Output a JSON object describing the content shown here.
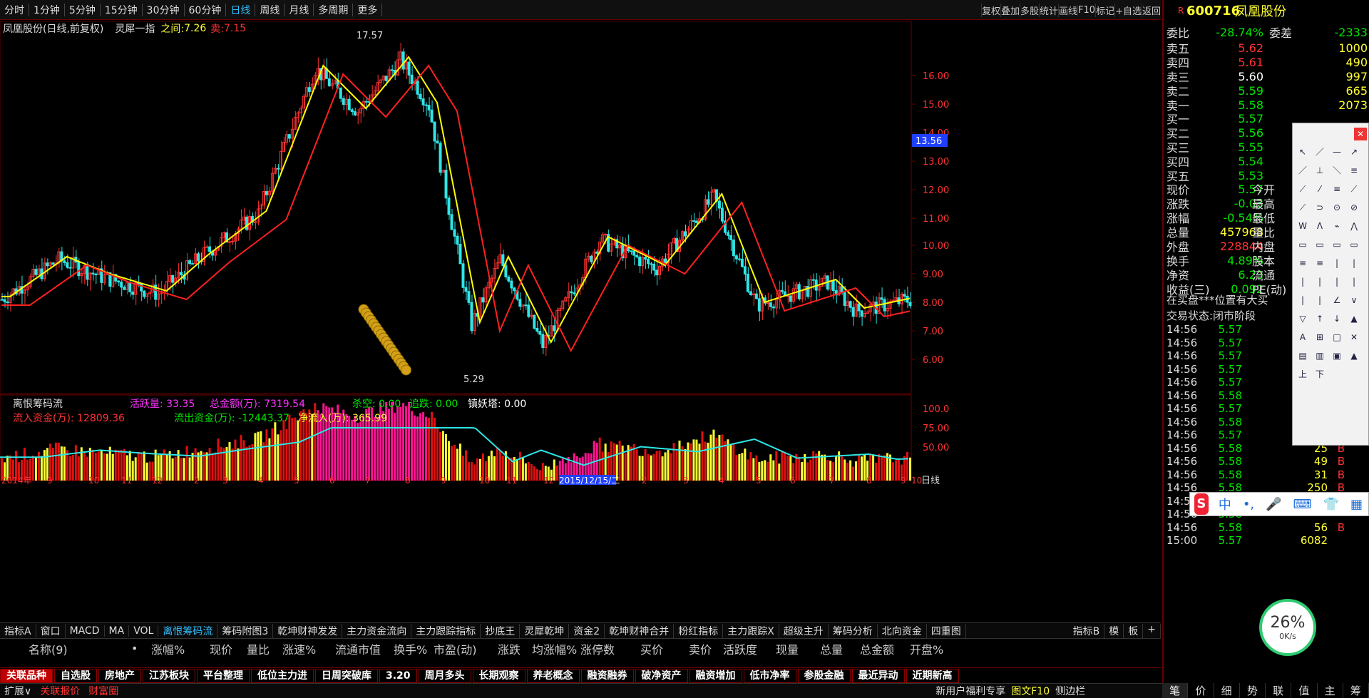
{
  "toolbar": {
    "periods": [
      "分时",
      "1分钟",
      "5分钟",
      "15分钟",
      "30分钟",
      "60分钟",
      "日线",
      "周线",
      "月线",
      "多周期",
      "更多"
    ],
    "active": "日线",
    "right": [
      "复权",
      "叠加",
      "多股",
      "统计",
      "画线",
      "F10",
      "标记",
      "+自选",
      "返回"
    ]
  },
  "chart": {
    "stock_title": "凤凰股份(日线,前复权)",
    "indicator_name": "灵犀一指",
    "between_label": "之间:",
    "between_value": "7.26",
    "sell_label": "卖:",
    "sell_value": "7.15",
    "high_label": "17.57",
    "low_label": "5.29",
    "current_price_tag": "13.56",
    "y_ticks": [
      "16.00",
      "15.00",
      "14.00",
      "13.00",
      "12.00",
      "11.00",
      "10.00",
      "9.00",
      "8.00",
      "7.00",
      "6.00"
    ],
    "date_labels": [
      "2014年",
      "9",
      "10",
      "11",
      "12",
      "2",
      "3",
      "4",
      "5",
      "6",
      "7",
      "8",
      "9",
      "10",
      "11",
      "12",
      "2015/12/15/二",
      "2",
      "3",
      "4",
      "5",
      "6",
      "7",
      "8",
      "9",
      "10"
    ],
    "period_label": "日线"
  },
  "sub": {
    "name": "离恨筹码流",
    "l1": "活跃量: 33.35",
    "l1b": "总金额(万): 7319.54",
    "l2": "杀空: 0.00",
    "l3": "追跌: 0.00",
    "l4": "镇妖塔: 0.00",
    "in": "流入资金(万): 12809.36",
    "out": "流出资金(万): -12443.37",
    "net": "净流入(万): 365.99",
    "y_ticks": [
      "100.0",
      "75.00",
      "50.00"
    ]
  },
  "tabs": [
    "指标A",
    "窗口",
    "MACD",
    "MA",
    "VOL",
    "离恨筹码流",
    "筹码附图3",
    "乾坤财神发发",
    "主力资金流向",
    "主力跟踪指标",
    "抄底王",
    "灵犀乾坤",
    "资金2",
    "乾坤财神合并",
    "粉红指标",
    "主力跟踪X",
    "超级主升",
    "筹码分析",
    "北向资金",
    "四重图"
  ],
  "tabs_active": "离恨筹码流",
  "tabs_right": [
    "指标B",
    "模",
    "板",
    "+"
  ],
  "table_header": [
    "名称(9)",
    "•",
    "涨幅%",
    "现价",
    "量比",
    "涨速%",
    "流通市值",
    "换手%",
    "市盈(动)",
    "涨跌",
    "均涨幅%",
    "涨停数",
    "买价",
    "卖价",
    "活跃度",
    "现量",
    "总量",
    "总金额",
    "开盘%"
  ],
  "sectors": [
    "关联品种",
    "自选股",
    "房地产",
    "江苏板块",
    "平台整理",
    "低位主力进",
    "日周突破库",
    "3.20",
    "周月多头",
    "长期观察",
    "养老概念",
    "融资融券",
    "破净资产",
    "融资增加",
    "低市净率",
    "参股金融",
    "最近异动",
    "近期新高"
  ],
  "status": {
    "items": [
      "扩展∨",
      "关联报价",
      "财富圈"
    ],
    "right": [
      "新用户福利专享",
      "图文F10",
      "侧边栏"
    ]
  },
  "quote": {
    "code": "600716",
    "name": "凤凰股份",
    "ratio_label": "委比",
    "ratio": "-28.74%",
    "diff_label": "委差",
    "diff": "-2333",
    "asks": [
      [
        "卖五",
        "5.62",
        "1000"
      ],
      [
        "卖四",
        "5.61",
        "490"
      ],
      [
        "卖三",
        "5.60",
        "997"
      ],
      [
        "卖二",
        "5.59",
        "665"
      ],
      [
        "卖一",
        "5.58",
        "2073"
      ]
    ],
    "bids": [
      [
        "买一",
        "5.57",
        ""
      ],
      [
        "买二",
        "5.56",
        ""
      ],
      [
        "买三",
        "5.55",
        ""
      ],
      [
        "买四",
        "5.54",
        ""
      ],
      [
        "买五",
        "5.53",
        ""
      ]
    ],
    "stats": [
      [
        "现价",
        "5.57",
        "今开"
      ],
      [
        "涨跌",
        "-0.03",
        "最高"
      ],
      [
        "涨幅",
        "-0.54%",
        "最低"
      ],
      [
        "总量",
        "457968",
        "量比"
      ],
      [
        "外盘",
        "228844",
        "内盘"
      ],
      [
        "换手",
        "4.89%",
        "股本"
      ],
      [
        "净资",
        "6.23",
        "流通"
      ],
      [
        "收益(三)",
        "0.092",
        "PE(动)"
      ]
    ],
    "notice1": "在买盘***位置有大买",
    "notice2": "交易状态:闭市阶段",
    "ticks": [
      [
        "14:56",
        "5.57",
        "",
        ""
      ],
      [
        "14:56",
        "5.57",
        "",
        ""
      ],
      [
        "14:56",
        "5.57",
        "",
        ""
      ],
      [
        "14:56",
        "5.57",
        "278",
        "S"
      ],
      [
        "14:56",
        "5.57",
        "88",
        "S"
      ],
      [
        "14:56",
        "5.58",
        "410",
        "B"
      ],
      [
        "14:56",
        "5.57",
        "",
        ""
      ],
      [
        "14:56",
        "5.58",
        "",
        ""
      ],
      [
        "14:56",
        "5.57",
        "105",
        "S"
      ],
      [
        "14:56",
        "5.58",
        "25",
        "B"
      ],
      [
        "14:56",
        "5.58",
        "49",
        "B"
      ],
      [
        "14:56",
        "5.58",
        "31",
        "B"
      ],
      [
        "14:56",
        "5.58",
        "250",
        "B"
      ],
      [
        "14:56",
        "5.58",
        "7",
        "B"
      ],
      [
        "14:56",
        "5.58",
        "",
        ""
      ],
      [
        "14:56",
        "5.58",
        "56",
        "B"
      ],
      [
        "15:00",
        "5.57",
        "6082",
        ""
      ]
    ],
    "bottom_tabs": [
      "笔",
      "价",
      "细",
      "势",
      "联",
      "值",
      "主",
      "筹"
    ]
  },
  "ime": {
    "items": [
      "中",
      "•,",
      "🎤",
      "⌨",
      "👕",
      "▦"
    ]
  },
  "speed": {
    "pct": "26%",
    "rate": "0K/s"
  }
}
